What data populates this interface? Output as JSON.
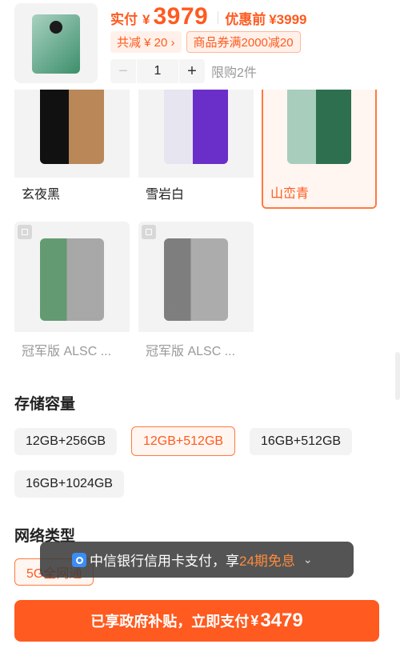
{
  "header": {
    "pay_label": "实付",
    "currency": "¥",
    "pay_amount": "3979",
    "orig_label": "优惠前",
    "orig_price": "¥3999",
    "promo_tags": [
      "共减 ¥ 20 ›",
      "商品券满2000减20"
    ],
    "quantity": "1",
    "qty_minus": "−",
    "qty_plus": "+",
    "limit_text": "限购2件"
  },
  "colors": {
    "items": [
      {
        "label": "玄夜黑",
        "tone": "#1d1d1f"
      },
      {
        "label": "雪岩白",
        "tone": "#ece9f2"
      },
      {
        "label": "山峦青",
        "tone": "#2f7a58"
      },
      {
        "label": "冠军版 ALSC ...",
        "tone": "#4a6a4a"
      },
      {
        "label": "冠军版 ALSC ...",
        "tone": "#6a6a6a"
      }
    ],
    "selected_index": 2
  },
  "storage": {
    "title": "存储容量",
    "options": [
      "12GB+256GB",
      "12GB+512GB",
      "16GB+512GB",
      "16GB+1024GB"
    ],
    "selected_index": 1
  },
  "network": {
    "title": "网络类型",
    "options": [
      "5G全网通"
    ]
  },
  "toast": {
    "text_before": "中信银行信用卡支付，享",
    "text_highlight": "24期免息",
    "chevron": "⌄"
  },
  "cta": {
    "text": "已享政府补贴，立即支付",
    "currency": "¥",
    "amount": "3479"
  },
  "colors_theme": {
    "accent": "#ff5a1f",
    "accent_light": "#fff6f1"
  }
}
